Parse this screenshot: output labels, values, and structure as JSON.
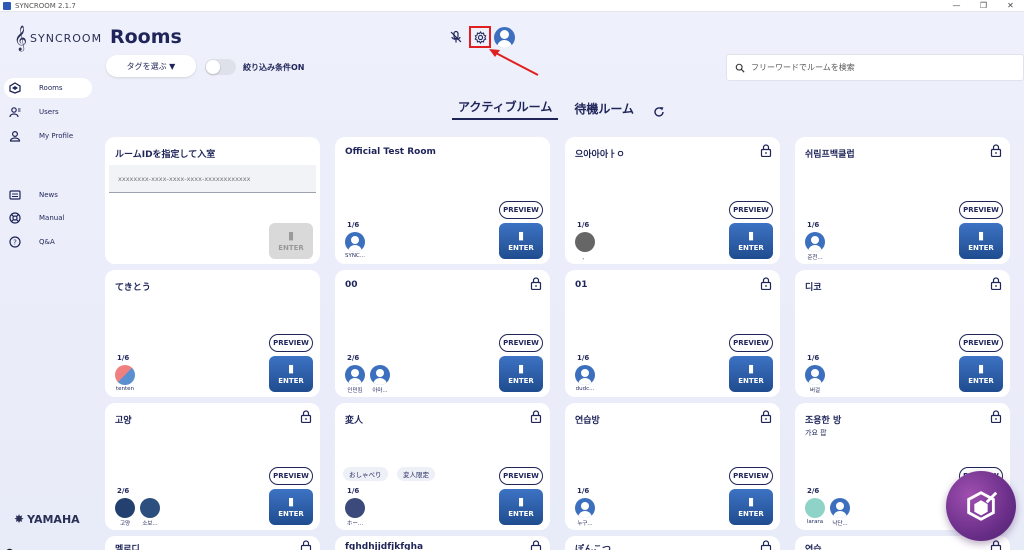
{
  "window": {
    "title": "SYNCROOM 2.1.7"
  },
  "sidebar": {
    "logo_text": "SYNCROOM",
    "items": [
      {
        "label": "Rooms",
        "icon": "rooms-icon",
        "active": true
      },
      {
        "label": "Users",
        "icon": "users-icon"
      },
      {
        "label": "My Profile",
        "icon": "profile-icon"
      },
      {
        "label": "News",
        "icon": "news-icon"
      },
      {
        "label": "Manual",
        "icon": "manual-icon"
      },
      {
        "label": "Q&A",
        "icon": "help-icon"
      }
    ],
    "brand": "YAMAHA"
  },
  "header": {
    "title": "Rooms",
    "tag_select_label": "タグを選ぶ ▼",
    "filter_toggle_label": "絞り込み条件ON",
    "search_placeholder": "フリーワードでルームを検索"
  },
  "tabs": [
    {
      "label": "アクティブルーム",
      "active": true
    },
    {
      "label": "待機ルーム",
      "active": false
    }
  ],
  "buttons": {
    "preview": "PREVIEW",
    "enter": "ENTER"
  },
  "colors": {
    "accent": "#1f2559",
    "enter_button": "#2b5ea8",
    "highlight_box": "#e02020"
  },
  "id_card": {
    "title": "ルームIDを指定して入室",
    "placeholder": "xxxxxxxx-xxxx-xxxx-xxxx-xxxxxxxxxxxx"
  },
  "rooms": [
    {
      "name": "Official Test Room",
      "locked": false,
      "count": "1/6",
      "members": [
        "SYNC..."
      ]
    },
    {
      "name": "으아아아ㅏㅇ",
      "locked": true,
      "count": "1/6",
      "members": [
        "、"
      ]
    },
    {
      "name": "쉬림프백클럽",
      "locked": true,
      "count": "1/6",
      "members": [
        "준천..."
      ]
    },
    {
      "name": "てきとう",
      "locked": false,
      "count": "1/6",
      "members": [
        "tenten"
      ]
    },
    {
      "name": "00",
      "locked": true,
      "count": "2/6",
      "members": [
        "인민킴",
        "아마..."
      ]
    },
    {
      "name": "01",
      "locked": true,
      "count": "1/6",
      "members": [
        "dudc..."
      ]
    },
    {
      "name": "디코",
      "locked": true,
      "count": "1/6",
      "members": [
        "버걸"
      ]
    },
    {
      "name": "고양",
      "locked": true,
      "count": "2/6",
      "members": [
        "고양",
        "소보..."
      ]
    },
    {
      "name": "変人",
      "locked": true,
      "count": "1/6",
      "members": [
        "ホー..."
      ],
      "tags": [
        "おしゃべり",
        "変人限定"
      ]
    },
    {
      "name": "연습방",
      "locked": true,
      "count": "1/6",
      "members": [
        "누구..."
      ]
    },
    {
      "name": "조용한 방",
      "subtitle": "가요 팝",
      "locked": true,
      "count": "2/6",
      "members": [
        "larara",
        "낙단..."
      ]
    },
    {
      "name": "멜로디",
      "locked": true
    },
    {
      "name": "fghdhjjdfjkfgha",
      "locked": true
    },
    {
      "name": "ぽんこつ",
      "locked": true
    },
    {
      "name": "연습",
      "locked": true
    }
  ]
}
